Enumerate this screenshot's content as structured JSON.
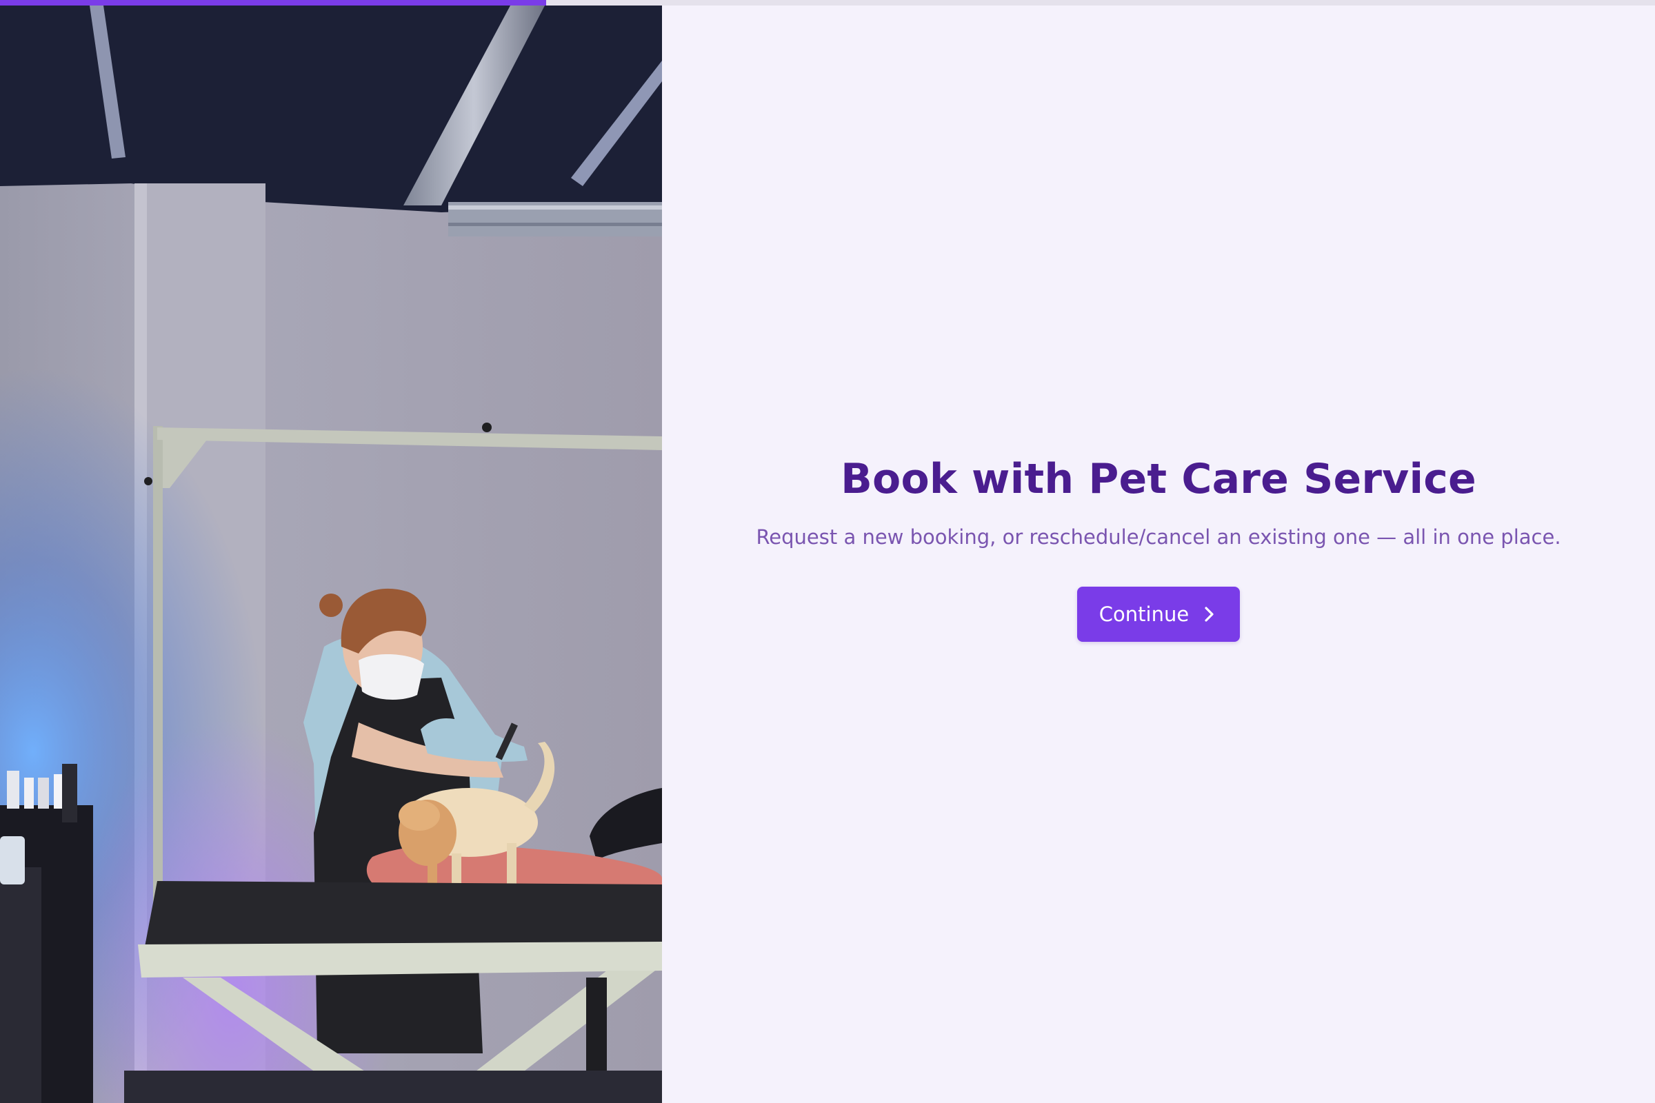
{
  "progress": {
    "percent": 33
  },
  "hero": {
    "image_subject": "groomer-brushing-cat-on-grooming-table"
  },
  "main": {
    "title": "Book with Pet Care Service",
    "subtitle": "Request a new booking, or reschedule/cancel an existing one — all in one place.",
    "continue_label": "Continue",
    "continue_icon": "chevron-right-icon"
  },
  "colors": {
    "accent": "#7a3ce8",
    "title": "#4a1d8f",
    "subtitle": "#7a55b0",
    "background": "#f5f2fc"
  }
}
